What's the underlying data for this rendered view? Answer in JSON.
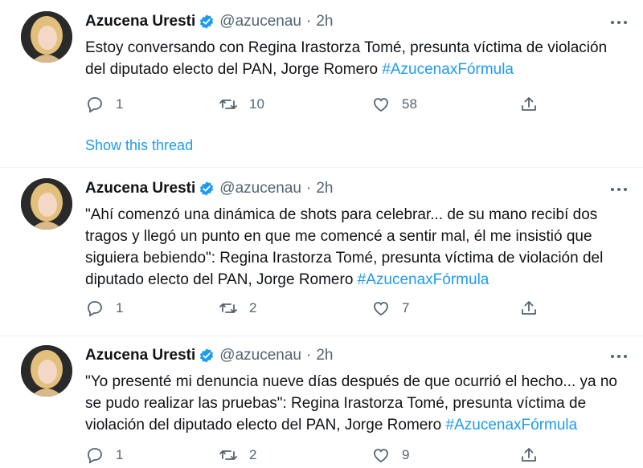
{
  "colors": {
    "accent": "#1d9bf0",
    "text": "#0f1419",
    "muted": "#536471"
  },
  "thread_link": "Show this thread",
  "tweets": [
    {
      "author": {
        "name": "Azucena Uresti",
        "handle": "@azucenau",
        "time": "2h",
        "verified": true
      },
      "text_plain": "Estoy conversando con Regina Irastorza Tomé, presunta víctima de violación del diputado electo del PAN, Jorge Romero ",
      "hashtag": "#AzucenaxFórmula",
      "stats": {
        "replies": "1",
        "retweets": "10",
        "likes": "58"
      }
    },
    {
      "author": {
        "name": "Azucena Uresti",
        "handle": "@azucenau",
        "time": "2h",
        "verified": true
      },
      "text_plain": "\"Ahí comenzó una dinámica de shots para celebrar... de su mano recibí dos tragos y llegó un punto en que me comencé a sentir mal, él me insistió que siguiera bebiendo\": Regina Irastorza Tomé, presunta víctima de violación del diputado electo del PAN, Jorge Romero ",
      "hashtag": "#AzucenaxFórmula",
      "stats": {
        "replies": "1",
        "retweets": "2",
        "likes": "7"
      }
    },
    {
      "author": {
        "name": "Azucena Uresti",
        "handle": "@azucenau",
        "time": "2h",
        "verified": true
      },
      "text_plain": "\"Yo presenté mi denuncia nueve días después de que ocurrió el hecho... ya no se pudo realizar las pruebas\": Regina Irastorza Tomé, presunta víctima de violación del diputado electo del PAN, Jorge Romero ",
      "hashtag": "#AzucenaxFórmula",
      "stats": {
        "replies": "1",
        "retweets": "2",
        "likes": "9"
      }
    }
  ]
}
